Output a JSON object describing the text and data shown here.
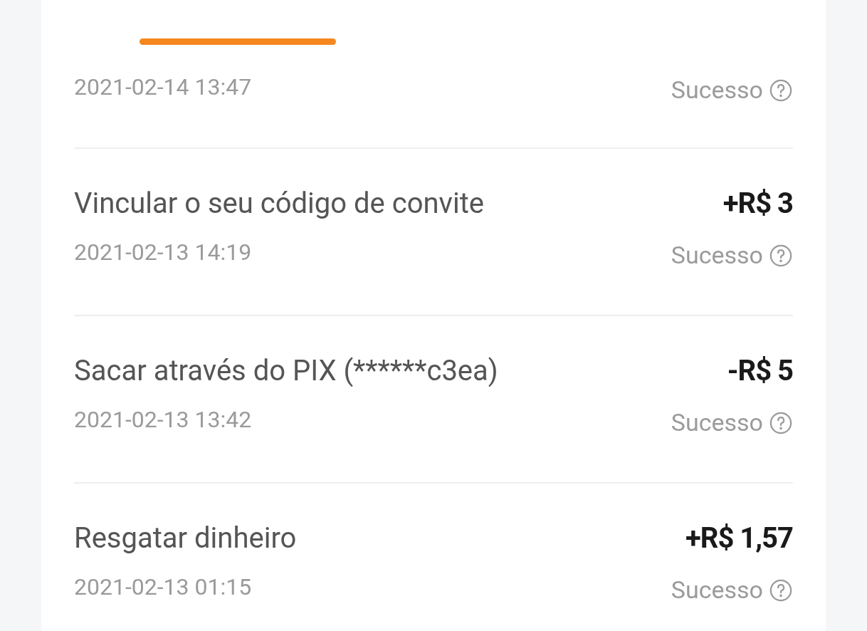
{
  "tabs": [
    {
      "selected": true
    }
  ],
  "transactions": [
    {
      "date": "2021-02-14 13:47",
      "status": "Sucesso"
    },
    {
      "title": "Vincular o seu código de convite",
      "amount": "+R$ 3",
      "date": "2021-02-13 14:19",
      "status": "Sucesso"
    },
    {
      "title": "Sacar através do PIX (******c3ea)",
      "amount": "-R$ 5",
      "date": "2021-02-13 13:42",
      "status": "Sucesso"
    },
    {
      "title": "Resgatar dinheiro",
      "amount": "+R$ 1,57",
      "date": "2021-02-13 01:15",
      "status": "Sucesso"
    }
  ]
}
